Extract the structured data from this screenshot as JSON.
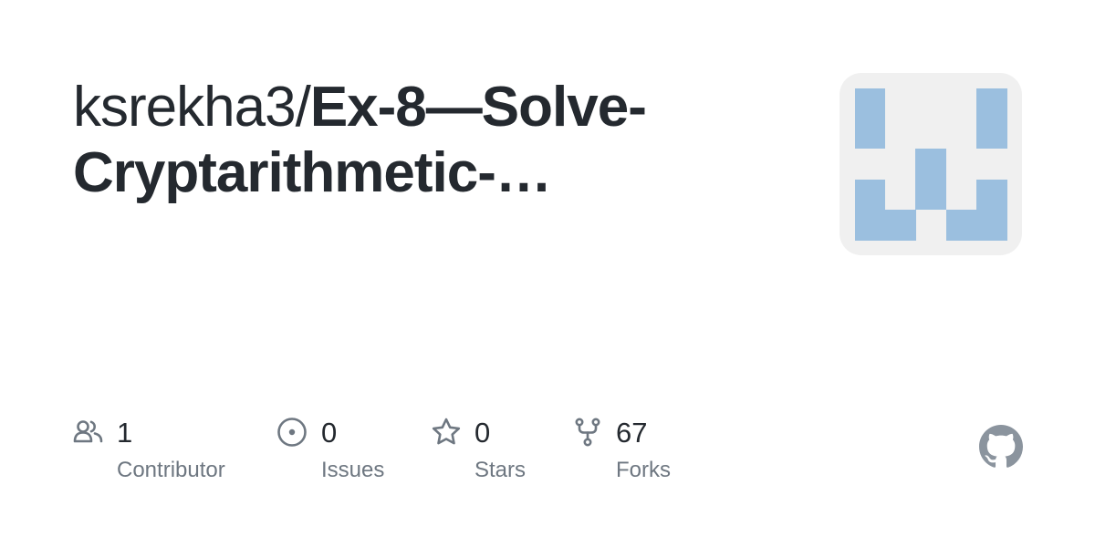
{
  "repo": {
    "owner": "ksrekha3/",
    "name_line1": "Ex-8—Solve-",
    "name_line2": "Cryptarithmetic-…"
  },
  "stats": [
    {
      "icon": "contributors-icon",
      "value": "1",
      "label": "Contributor"
    },
    {
      "icon": "issues-icon",
      "value": "0",
      "label": "Issues"
    },
    {
      "icon": "star-icon",
      "value": "0",
      "label": "Stars"
    },
    {
      "icon": "fork-icon",
      "value": "67",
      "label": "Forks"
    }
  ],
  "brand": {
    "logo": "github-icon",
    "avatar": "identicon-avatar"
  },
  "colors": {
    "text": "#24292f",
    "muted": "#6e7781",
    "identicon": "#9bbfdf",
    "avatar_bg": "#f0f0f0"
  }
}
